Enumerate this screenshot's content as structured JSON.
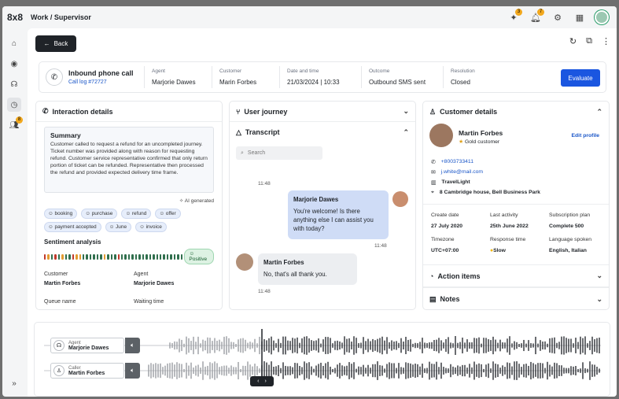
{
  "app": {
    "brand": "8x8",
    "title": "Work / Supervisor",
    "notif_badges": [
      "3",
      "7"
    ],
    "nav_badge": "8"
  },
  "toolbar": {
    "back_label": "Back"
  },
  "call": {
    "title": "Inbound phone call",
    "log_link": "Call log #72727",
    "fields": [
      {
        "label": "Agent",
        "value": "Marjorie Dawes"
      },
      {
        "label": "Customer",
        "value": "Marin Forbes"
      },
      {
        "label": "Date and time",
        "value": "21/03/2024 | 10:33"
      },
      {
        "label": "Outcome",
        "value": "Outbound SMS sent"
      },
      {
        "label": "Resolution",
        "value": "Closed"
      }
    ],
    "evaluate_label": "Evaluate"
  },
  "interaction": {
    "header": "Interaction details",
    "summary_title": "Summary",
    "summary_body": "Customer called to request a refund for an uncompleted journey. Ticket number was provided along with reason for requesting refund. Customer service representative confirmed that only return portion of ticket can be refunded. Representative then processed the refund and provided expected delivery time frame.",
    "ai_label": "AI generated",
    "tags": [
      "booking",
      "purchase",
      "refund",
      "offer",
      "payment accepted",
      "June",
      "invoice"
    ],
    "sentiment_title": "Sentiment analysis",
    "sentiment_colors": [
      "#c0392b",
      "#e39b31",
      "#2f6e4c",
      "#c0392b",
      "#2f6e4c",
      "#e39b31",
      "#2f6e4c",
      "#2f6e4c",
      "#c0392b",
      "#e39b31",
      "#e39b31",
      "#2f6e4c",
      "#2f6e4c",
      "#2f6e4c",
      "#2f6e4c",
      "#2f6e4c",
      "#2f6e4c",
      "#e39b31",
      "#2f6e4c",
      "#2f6e4c",
      "#2f6e4c",
      "#c0392b",
      "#2f6e4c",
      "#2f6e4c",
      "#2f6e4c",
      "#2f6e4c",
      "#2f6e4c",
      "#2f6e4c",
      "#2f6e4c",
      "#2f6e4c",
      "#2f6e4c",
      "#2f6e4c",
      "#2f6e4c",
      "#2f6e4c",
      "#2f6e4c",
      "#2f6e4c",
      "#2f6e4c",
      "#2f6e4c",
      "#2f6e4c",
      "#2f6e4c"
    ],
    "sentiment_label": "Positive",
    "kv": [
      {
        "k": "Customer",
        "v": "Martin Forbes"
      },
      {
        "k": "Agent",
        "v": "Marjorie Dawes"
      },
      {
        "k": "Queue name",
        "v": ""
      },
      {
        "k": "Waiting time",
        "v": ""
      }
    ]
  },
  "journey": {
    "header": "User journey"
  },
  "transcript": {
    "header": "Transcript",
    "search_placeholder": "Search",
    "messages": [
      {
        "time": "11:48"
      },
      {
        "name": "Marjorie Dawes",
        "text": "You're welcome! Is there anything else I can assist you with today?",
        "time": "11:48"
      },
      {
        "name": "Martin Forbes",
        "text": "No, that's all thank you.",
        "time": "11:48"
      }
    ]
  },
  "customer": {
    "header": "Customer details",
    "name": "Martin Forbes",
    "tier": "Gold customer",
    "edit_label": "Edit profile",
    "phone": "+8003733411",
    "email": "j.white@mail.com",
    "company": "TravelLight",
    "address": "8 Cambridge house, Bell Business Park",
    "stats": [
      {
        "k": "Create date",
        "v": "27 July 2020"
      },
      {
        "k": "Last activity",
        "v": "25th June 2022"
      },
      {
        "k": "Subscription plan",
        "v": "Complete 500"
      },
      {
        "k": "Timezone",
        "v": "UTC+07:00"
      },
      {
        "k": "Response time",
        "v": "Slow"
      },
      {
        "k": "Language spoken",
        "v": "English, Italian"
      }
    ],
    "action_items": "Action items",
    "notes": "Notes"
  },
  "tracks": [
    {
      "role": "Agent",
      "name": "Marjorie Dawes"
    },
    {
      "role": "Caller",
      "name": "Martin Forbes"
    }
  ]
}
